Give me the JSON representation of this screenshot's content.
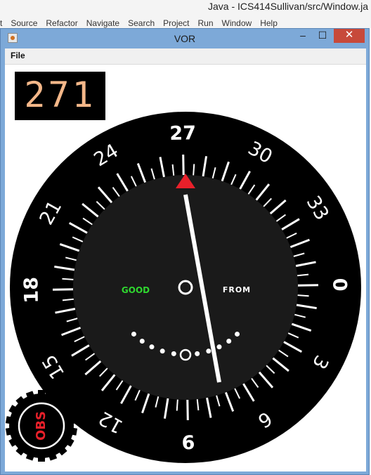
{
  "ide": {
    "title": "Java - ICS414Sullivan/src/Window.ja",
    "menu": [
      "t",
      "Source",
      "Refactor",
      "Navigate",
      "Search",
      "Project",
      "Run",
      "Window",
      "Help"
    ]
  },
  "window": {
    "title": "VOR",
    "controls": {
      "minimize": "–",
      "maximize": "☐",
      "close": "✕"
    }
  },
  "menubar": {
    "file": "File"
  },
  "readout": {
    "value": "271"
  },
  "instrument": {
    "ring_labels": [
      "0",
      "3",
      "6",
      "9",
      "12",
      "15",
      "18",
      "21",
      "24",
      "27",
      "30",
      "33"
    ],
    "signal": "GOOD",
    "to_from": "FROM",
    "obs_knob": "OBS",
    "pointer_heading": 271,
    "needle_deflection": 0.3,
    "colors": {
      "bezel": "#000000",
      "face": "#1a1a1a",
      "signal": "#2fd72f",
      "to_from": "#ffffff",
      "pointer": "#e8202a",
      "obs": "#e8202a"
    }
  }
}
